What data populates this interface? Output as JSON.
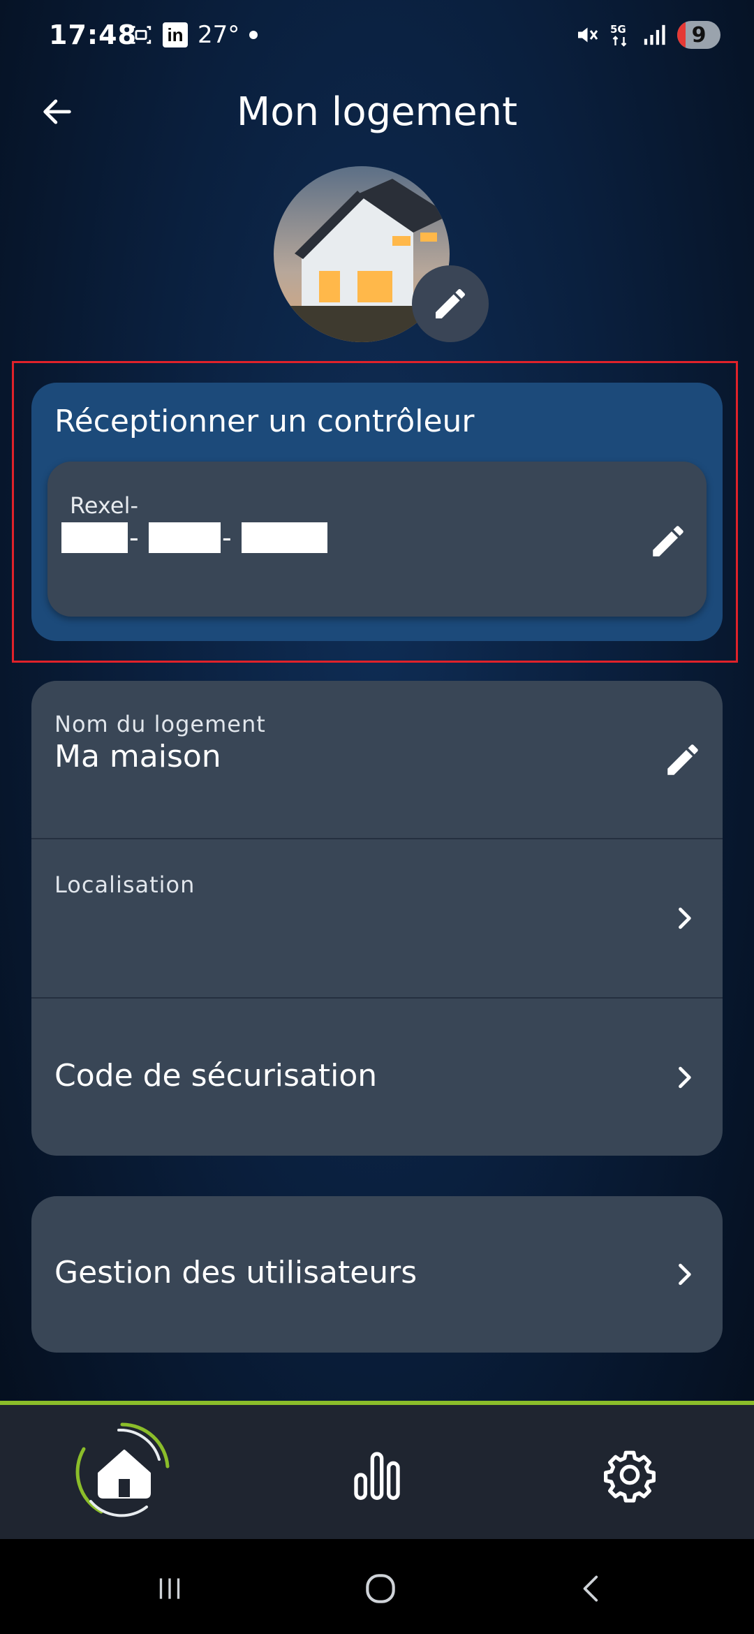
{
  "status_bar": {
    "time": "17:48",
    "linkedin": "in",
    "temperature": "27°",
    "battery": "9"
  },
  "header": {
    "title": "Mon logement"
  },
  "controller": {
    "title": "Réceptionner un contrôleur",
    "label": "Rexel-"
  },
  "home_info": {
    "name_label": "Nom du logement",
    "name_value": "Ma maison",
    "location_label": "Localisation",
    "security_label": "Code de sécurisation"
  },
  "users": {
    "label": "Gestion des utilisateurs"
  },
  "colors": {
    "accent": "#8bbd2a",
    "card": "#394656",
    "controller_card": "#1c4a7a",
    "highlight": "#e0222a"
  },
  "icons": {
    "back": "arrow-left-icon",
    "edit": "pencil-icon",
    "chevron": "chevron-right-icon",
    "nav_home": "home-icon",
    "nav_stats": "bar-chart-icon",
    "nav_settings": "gear-icon"
  }
}
